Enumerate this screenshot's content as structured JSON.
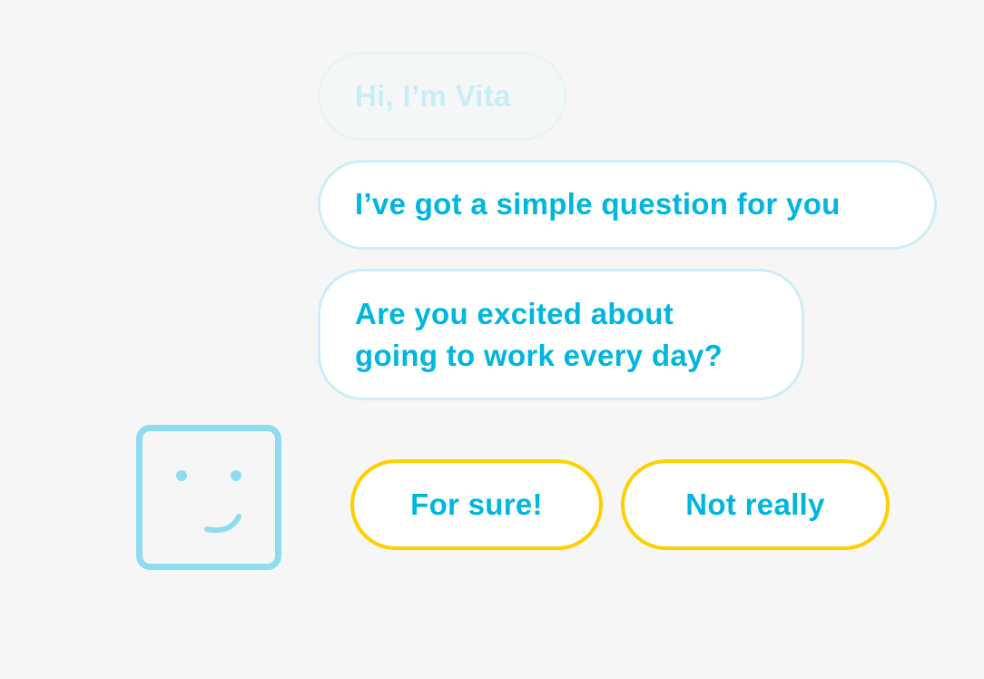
{
  "messages": {
    "greeting": "Hi, I’m Vita",
    "intro": "I’ve got a simple question for you",
    "question_line1": "Are you excited about",
    "question_line2": "going to work every day?"
  },
  "avatar": {
    "icon": "smiley-face-icon",
    "color": "#8fdcf0"
  },
  "choices": [
    {
      "label": "For sure!"
    },
    {
      "label": "Not really"
    }
  ],
  "colors": {
    "background": "#f6f6f6",
    "text": "#00b6de",
    "bubble_border": "#cdeef6",
    "choice_border": "#ffd000"
  }
}
